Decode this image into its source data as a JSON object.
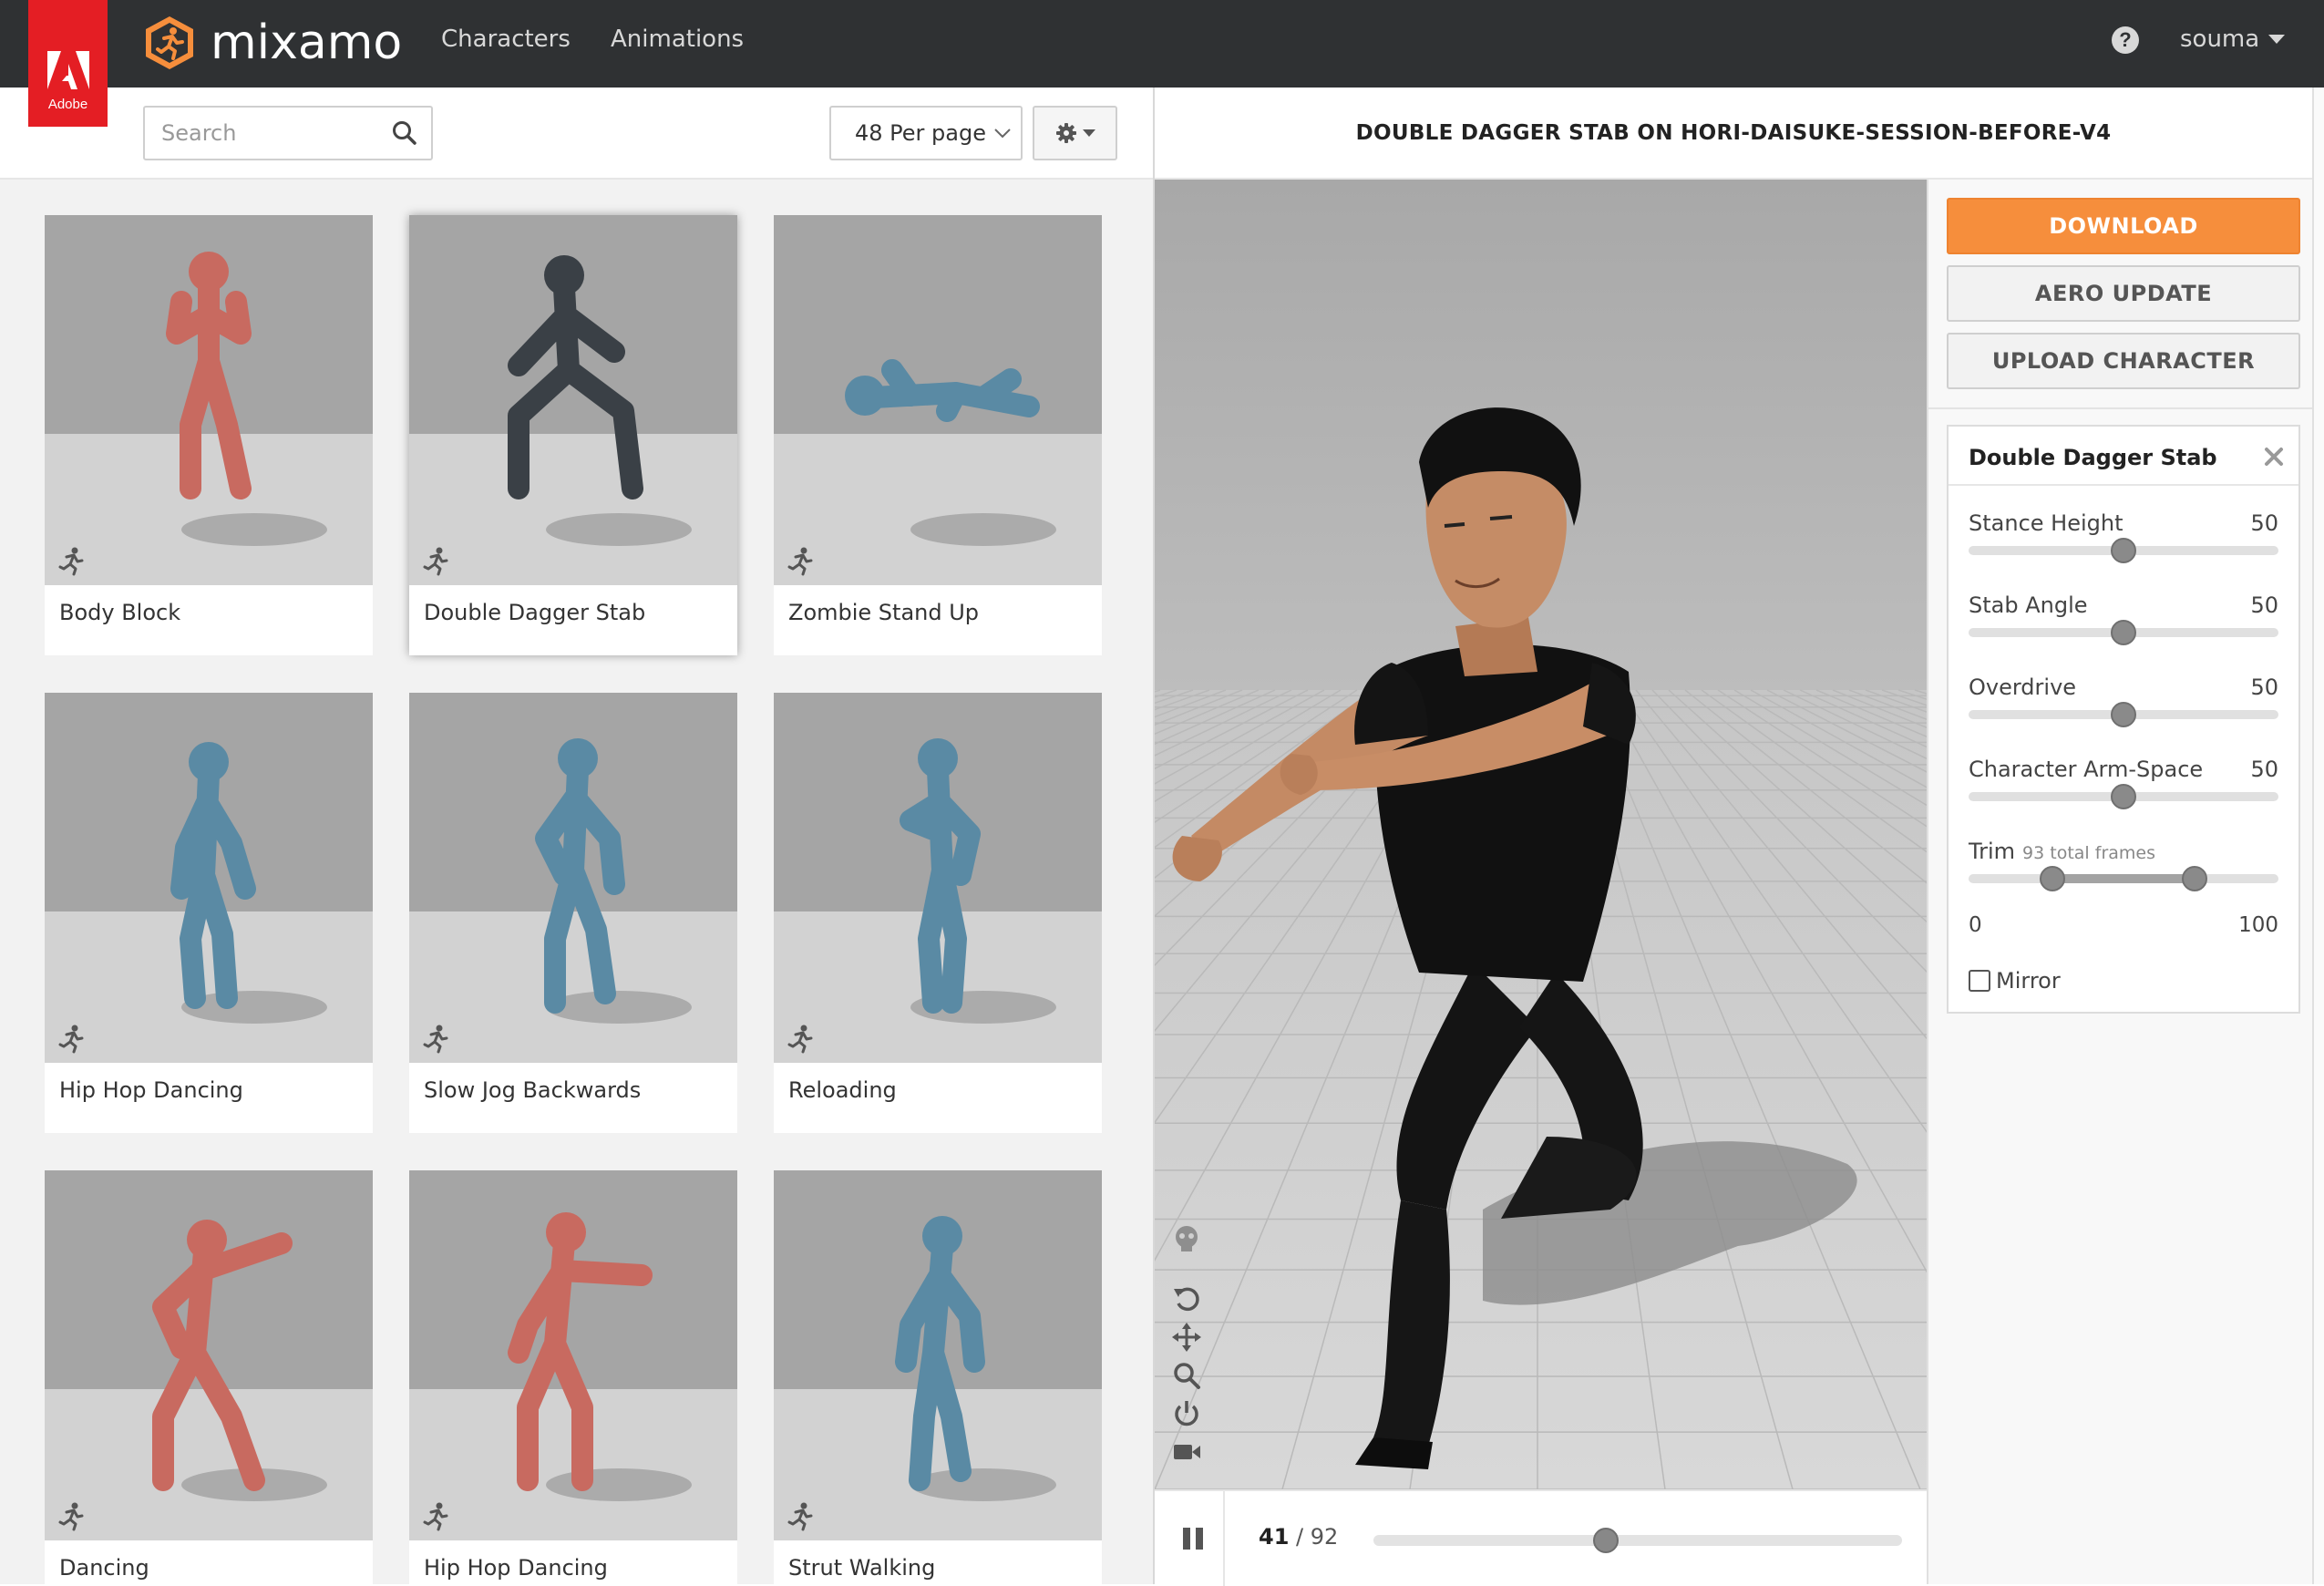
{
  "adobe": {
    "label": "Adobe"
  },
  "brand": {
    "name": "mixamo"
  },
  "nav": {
    "characters": "Characters",
    "animations": "Animations"
  },
  "help": {
    "glyph": "?"
  },
  "user": {
    "name": "souma"
  },
  "search": {
    "placeholder": "Search"
  },
  "per_page": {
    "selected": "48 Per page"
  },
  "colors": {
    "accent": "#f68e3c",
    "topbar": "#2f3133",
    "adobe_red": "#e41e24",
    "mannequin_red": "#c86a60",
    "mannequin_blue": "#5a8aa4"
  },
  "grid": {
    "cards": [
      {
        "title": "Body Block",
        "figure": "red"
      },
      {
        "title": "Double Dagger Stab",
        "figure": "soldier"
      },
      {
        "title": "Zombie Stand Up",
        "figure": "blue"
      },
      {
        "title": "Hip Hop Dancing",
        "figure": "blue"
      },
      {
        "title": "Slow Jog Backwards",
        "figure": "blue"
      },
      {
        "title": "Reloading",
        "figure": "blue"
      },
      {
        "title": "Dancing",
        "figure": "red"
      },
      {
        "title": "Hip Hop Dancing",
        "figure": "red"
      },
      {
        "title": "Strut Walking",
        "figure": "blue"
      }
    ]
  },
  "preview": {
    "title": "DOUBLE DAGGER STAB ON HORI-DAISUKE-SESSION-BEFORE-V4"
  },
  "playback": {
    "current_frame": "41",
    "separator": " / ",
    "total_frames": "92",
    "progress": 0.44
  },
  "actions": {
    "download": "DOWNLOAD",
    "aero_update": "AERO UPDATE",
    "upload_character": "UPLOAD CHARACTER"
  },
  "settings": {
    "title": "Double Dagger Stab",
    "params": [
      {
        "label": "Stance Height",
        "value": "50",
        "fraction": 0.5
      },
      {
        "label": "Stab Angle",
        "value": "50",
        "fraction": 0.5
      },
      {
        "label": "Overdrive",
        "value": "50",
        "fraction": 0.5
      },
      {
        "label": "Character Arm-Space",
        "value": "50",
        "fraction": 0.5
      }
    ],
    "trim": {
      "label": "Trim",
      "sub": "93 total frames",
      "min": "0",
      "max": "100",
      "start_fraction": 0.27,
      "end_fraction": 0.73
    },
    "mirror": {
      "label": "Mirror",
      "checked": false
    }
  }
}
